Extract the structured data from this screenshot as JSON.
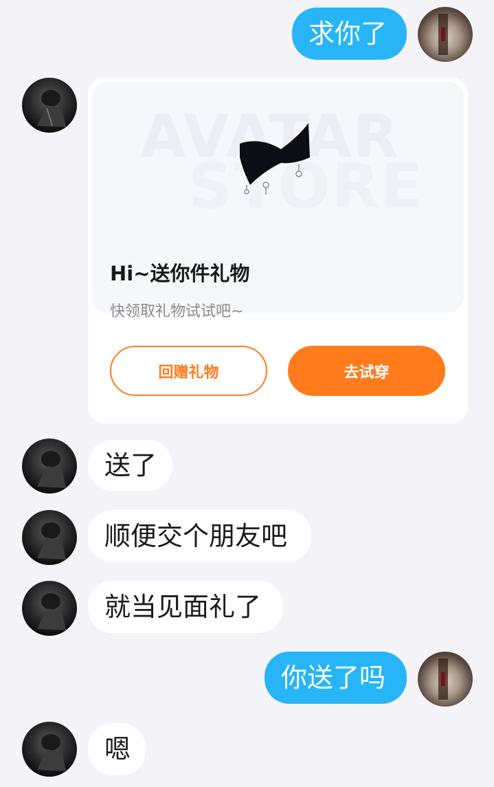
{
  "messages": {
    "m1": "求你了",
    "m3": "送了",
    "m4": "顺便交个朋友吧",
    "m5": "就当见面礼了",
    "m6": "你送了吗",
    "m7": "嗯"
  },
  "gift_card": {
    "title": "Hi~送你件礼物",
    "subtitle": "快领取礼物试试吧~",
    "return_gift_label": "回赠礼物",
    "try_on_label": "去试穿",
    "banner_watermark_top": "AVATAR",
    "banner_watermark_bottom": "STORE"
  },
  "colors": {
    "self_bubble": "#27b5f7",
    "other_bubble": "#ffffff",
    "accent_orange": "#ff7b1c",
    "background": "#f4f4f8"
  }
}
